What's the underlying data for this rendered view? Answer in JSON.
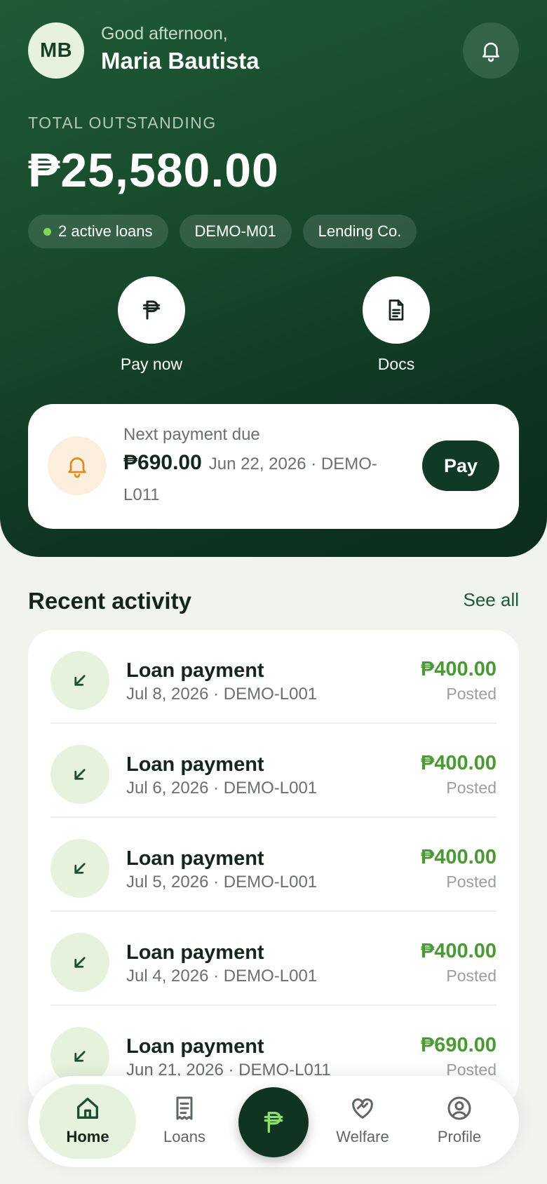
{
  "header": {
    "initials": "MB",
    "greeting": "Good afternoon,",
    "user_name": "Maria Bautista",
    "notification_icon": "bell-icon"
  },
  "summary": {
    "label": "TOTAL OUTSTANDING",
    "amount": "₱25,580.00",
    "chips": [
      "2 active loans",
      "DEMO-M01",
      "Lending Co."
    ]
  },
  "quick_actions": [
    {
      "label": "Pay now",
      "icon": "peso-icon"
    },
    {
      "label": "Docs",
      "icon": "document-icon"
    }
  ],
  "next_payment": {
    "title": "Next payment due",
    "amount": "₱690.00",
    "detail": "Jun 22, 2026 · DEMO-L011",
    "button": "Pay",
    "icon": "bell-icon"
  },
  "activity": {
    "title": "Recent activity",
    "see_all": "See all",
    "items": [
      {
        "title": "Loan payment",
        "sub": "Jul 8, 2026 · DEMO-L001",
        "amount": "₱400.00",
        "status": "Posted"
      },
      {
        "title": "Loan payment",
        "sub": "Jul 6, 2026 · DEMO-L001",
        "amount": "₱400.00",
        "status": "Posted"
      },
      {
        "title": "Loan payment",
        "sub": "Jul 5, 2026 · DEMO-L001",
        "amount": "₱400.00",
        "status": "Posted"
      },
      {
        "title": "Loan payment",
        "sub": "Jul 4, 2026 · DEMO-L001",
        "amount": "₱400.00",
        "status": "Posted"
      },
      {
        "title": "Loan payment",
        "sub": "Jun 21, 2026 · DEMO-L011",
        "amount": "₱690.00",
        "status": "Posted"
      }
    ]
  },
  "nav": {
    "items": [
      {
        "label": "Home",
        "icon": "home-icon",
        "active": true
      },
      {
        "label": "Loans",
        "icon": "receipt-icon",
        "active": false
      },
      {
        "label": "Welfare",
        "icon": "heart-handshake-icon",
        "active": false
      },
      {
        "label": "Profile",
        "icon": "user-circle-icon",
        "active": false
      }
    ],
    "center_icon": "peso-icon"
  },
  "colors": {
    "brand_dark": "#0f3522",
    "accent_green": "#4a9a33",
    "active_dot": "#7ed957",
    "warning": "#e08a1e"
  }
}
